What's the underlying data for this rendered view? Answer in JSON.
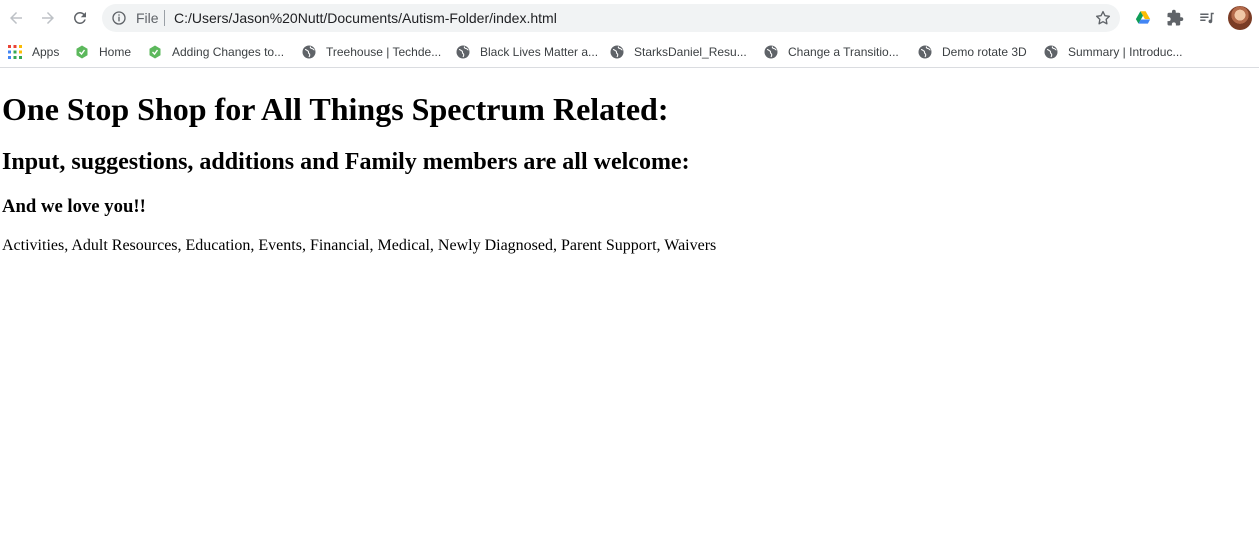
{
  "browser": {
    "omnibox": {
      "scheme_label": "File",
      "url": "C:/Users/Jason%20Nutt/Documents/Autism-Folder/index.html"
    },
    "bookmarks": [
      {
        "label": "Apps",
        "icon": "apps-grid-icon"
      },
      {
        "label": "Home",
        "icon": "green-leaf-icon"
      },
      {
        "label": "Adding Changes to...",
        "icon": "green-leaf-icon"
      },
      {
        "label": "Treehouse | Techde...",
        "icon": "globe-icon"
      },
      {
        "label": "Black Lives Matter a...",
        "icon": "globe-icon"
      },
      {
        "label": "StarksDaniel_Resu...",
        "icon": "globe-icon"
      },
      {
        "label": "Change a Transitio...",
        "icon": "globe-icon"
      },
      {
        "label": "Demo rotate 3D",
        "icon": "globe-icon"
      },
      {
        "label": "Summary | Introduc...",
        "icon": "globe-icon"
      }
    ]
  },
  "page": {
    "heading1": "One Stop Shop for All Things Spectrum Related:",
    "heading2": "Input, suggestions, additions and Family members are all welcome:",
    "heading3": "And we love you!!",
    "categories_text": "Activities, Adult Resources, Education, Events, Financial, Medical, Newly Diagnosed, Parent Support, Waivers"
  },
  "colors": {
    "omnibox_bg": "#f1f3f4",
    "icon_gray": "#5f6368",
    "text_dark": "#202124"
  }
}
